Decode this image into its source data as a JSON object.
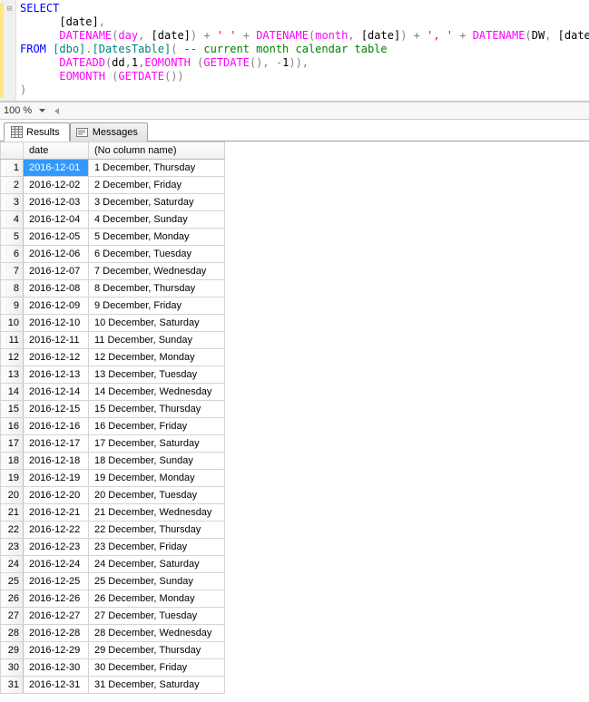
{
  "editor": {
    "collapse_glyph": "⊟",
    "code": {
      "l1_select": "SELECT",
      "l2_indent": "      ",
      "l2_date": "[date]",
      "l2_comma": ",",
      "l3_indent": "      ",
      "l3_fn1": "DATENAME",
      "l3_p1": "(",
      "l3_day": "day",
      "l3_c1": ",",
      "l3_sp1": " ",
      "l3_d1": "[date]",
      "l3_p2": ")",
      "l3_plus1": " + ",
      "l3_str1": "' '",
      "l3_plus2": " + ",
      "l3_fn2": "DATENAME",
      "l3_p3": "(",
      "l3_month": "month",
      "l3_c2": ",",
      "l3_sp2": " ",
      "l3_d2": "[date]",
      "l3_p4": ")",
      "l3_plus3": " + ",
      "l3_str2": "', '",
      "l3_plus4": " + ",
      "l3_fn3": "DATENAME",
      "l3_p5": "(",
      "l3_dw": "DW",
      "l3_c3": ",",
      "l3_sp3": " ",
      "l3_d3": "[date]",
      "l3_p6": ")",
      "l4_from": "FROM",
      "l4_sp": " ",
      "l4_dbo": "[dbo]",
      "l4_dot": ".",
      "l4_tbl": "[DatesTable]",
      "l4_p": "(",
      "l4_sp2": " ",
      "l4_cmt": "-- current month calendar table",
      "l5_indent": "      ",
      "l5_fn1": "DATEADD",
      "l5_p1": "(",
      "l5_dd": "dd",
      "l5_c1": ",",
      "l5_1": "1",
      "l5_c2": ",",
      "l5_fn2": "EOMONTH",
      "l5_sp1": " ",
      "l5_p2": "(",
      "l5_fn3": "GETDATE",
      "l5_p3": "()",
      "l5_c3": ",",
      "l5_sp2": " ",
      "l5_m1a": "-",
      "l5_m1b": "1",
      "l5_p4": "))",
      "l5_c4": ",",
      "l6_indent": "      ",
      "l6_fn1": "EOMONTH",
      "l6_sp": " ",
      "l6_p1": "(",
      "l6_fn2": "GETDATE",
      "l6_p2": "())",
      "l7_close": ")"
    }
  },
  "zoom": {
    "level": "100 %"
  },
  "tabs": {
    "results": "Results",
    "messages": "Messages"
  },
  "results": {
    "headers": {
      "date": "date",
      "col2": "(No column name)"
    },
    "rows": [
      {
        "n": "1",
        "date": "2016-12-01",
        "val": "1 December, Thursday"
      },
      {
        "n": "2",
        "date": "2016-12-02",
        "val": "2 December, Friday"
      },
      {
        "n": "3",
        "date": "2016-12-03",
        "val": "3 December, Saturday"
      },
      {
        "n": "4",
        "date": "2016-12-04",
        "val": "4 December, Sunday"
      },
      {
        "n": "5",
        "date": "2016-12-05",
        "val": "5 December, Monday"
      },
      {
        "n": "6",
        "date": "2016-12-06",
        "val": "6 December, Tuesday"
      },
      {
        "n": "7",
        "date": "2016-12-07",
        "val": "7 December, Wednesday"
      },
      {
        "n": "8",
        "date": "2016-12-08",
        "val": "8 December, Thursday"
      },
      {
        "n": "9",
        "date": "2016-12-09",
        "val": "9 December, Friday"
      },
      {
        "n": "10",
        "date": "2016-12-10",
        "val": "10 December, Saturday"
      },
      {
        "n": "11",
        "date": "2016-12-11",
        "val": "11 December, Sunday"
      },
      {
        "n": "12",
        "date": "2016-12-12",
        "val": "12 December, Monday"
      },
      {
        "n": "13",
        "date": "2016-12-13",
        "val": "13 December, Tuesday"
      },
      {
        "n": "14",
        "date": "2016-12-14",
        "val": "14 December, Wednesday"
      },
      {
        "n": "15",
        "date": "2016-12-15",
        "val": "15 December, Thursday"
      },
      {
        "n": "16",
        "date": "2016-12-16",
        "val": "16 December, Friday"
      },
      {
        "n": "17",
        "date": "2016-12-17",
        "val": "17 December, Saturday"
      },
      {
        "n": "18",
        "date": "2016-12-18",
        "val": "18 December, Sunday"
      },
      {
        "n": "19",
        "date": "2016-12-19",
        "val": "19 December, Monday"
      },
      {
        "n": "20",
        "date": "2016-12-20",
        "val": "20 December, Tuesday"
      },
      {
        "n": "21",
        "date": "2016-12-21",
        "val": "21 December, Wednesday"
      },
      {
        "n": "22",
        "date": "2016-12-22",
        "val": "22 December, Thursday"
      },
      {
        "n": "23",
        "date": "2016-12-23",
        "val": "23 December, Friday"
      },
      {
        "n": "24",
        "date": "2016-12-24",
        "val": "24 December, Saturday"
      },
      {
        "n": "25",
        "date": "2016-12-25",
        "val": "25 December, Sunday"
      },
      {
        "n": "26",
        "date": "2016-12-26",
        "val": "26 December, Monday"
      },
      {
        "n": "27",
        "date": "2016-12-27",
        "val": "27 December, Tuesday"
      },
      {
        "n": "28",
        "date": "2016-12-28",
        "val": "28 December, Wednesday"
      },
      {
        "n": "29",
        "date": "2016-12-29",
        "val": "29 December, Thursday"
      },
      {
        "n": "30",
        "date": "2016-12-30",
        "val": "30 December, Friday"
      },
      {
        "n": "31",
        "date": "2016-12-31",
        "val": "31 December, Saturday"
      }
    ]
  }
}
